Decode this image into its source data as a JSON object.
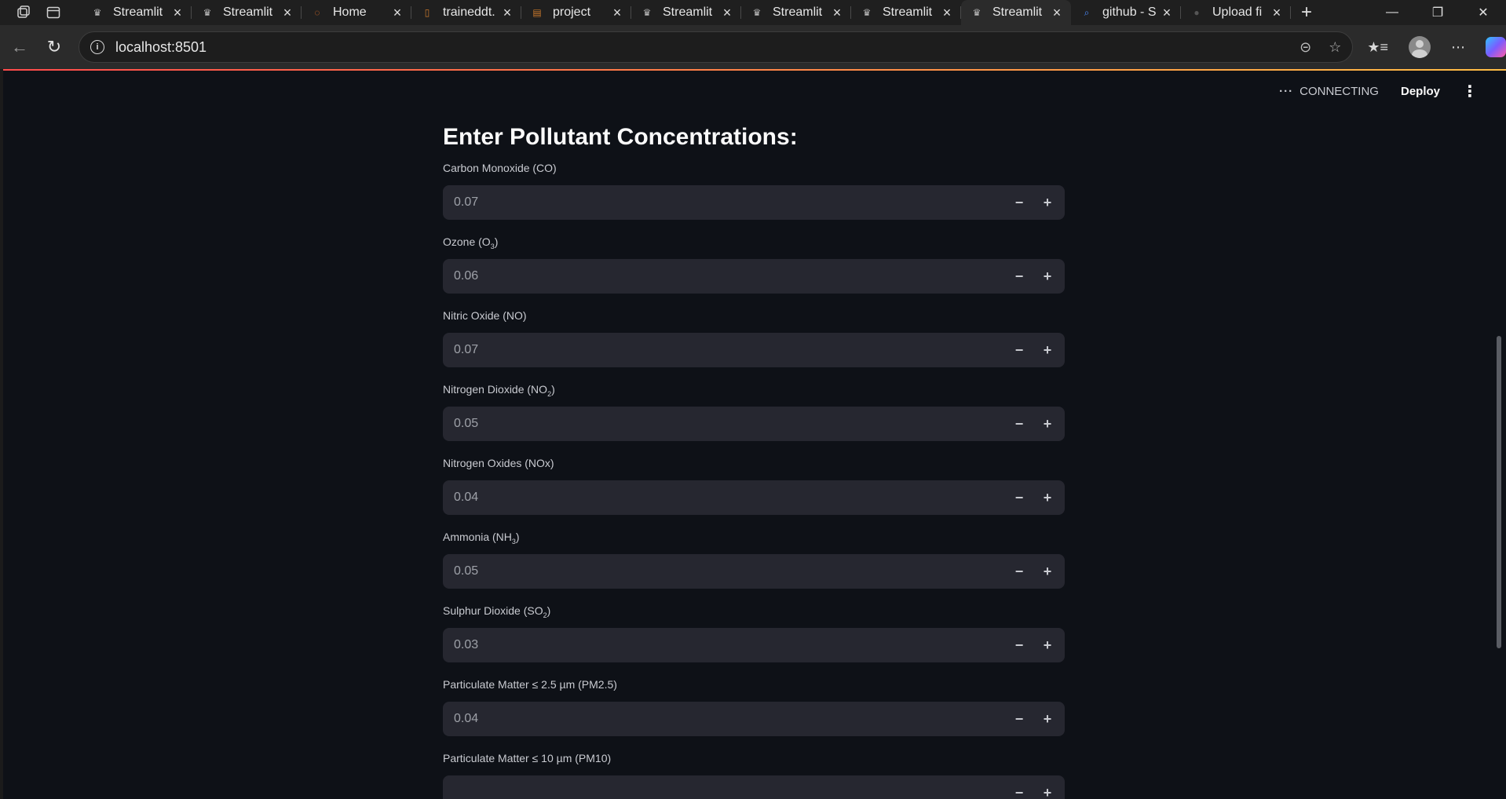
{
  "browser": {
    "tabs": [
      {
        "title": "Streamlit",
        "icon": "streamlit-crown-icon",
        "active": false
      },
      {
        "title": "Streamlit",
        "icon": "streamlit-crown-icon",
        "active": false
      },
      {
        "title": "Home",
        "icon": "jupyter-icon",
        "active": false
      },
      {
        "title": "traineddt.",
        "icon": "file-icon",
        "active": false
      },
      {
        "title": "project",
        "icon": "notebook-icon",
        "active": false
      },
      {
        "title": "Streamlit",
        "icon": "streamlit-crown-icon",
        "active": false
      },
      {
        "title": "Streamlit",
        "icon": "streamlit-crown-icon",
        "active": false
      },
      {
        "title": "Streamlit",
        "icon": "streamlit-crown-icon",
        "active": false
      },
      {
        "title": "Streamlit",
        "icon": "streamlit-crown-icon",
        "active": true
      },
      {
        "title": "github - S",
        "icon": "search-icon",
        "active": false
      },
      {
        "title": "Upload fi",
        "icon": "github-icon",
        "active": false
      }
    ],
    "url": "localhost:8501"
  },
  "app": {
    "status": {
      "connection": "CONNECTING",
      "deploy_label": "Deploy"
    },
    "heading": "Enter Pollutant Concentrations:",
    "fields": [
      {
        "label": "Carbon Monoxide (CO)",
        "sub": "",
        "suffix": "",
        "value": "0.07"
      },
      {
        "label": "Ozone (O",
        "sub": "3",
        "suffix": ")",
        "value": "0.06"
      },
      {
        "label": "Nitric Oxide (NO)",
        "sub": "",
        "suffix": "",
        "value": "0.07"
      },
      {
        "label": "Nitrogen Dioxide (NO",
        "sub": "2",
        "suffix": ")",
        "value": "0.05"
      },
      {
        "label": "Nitrogen Oxides (NOx)",
        "sub": "",
        "suffix": "",
        "value": "0.04"
      },
      {
        "label": "Ammonia (NH",
        "sub": "3",
        "suffix": ")",
        "value": "0.05"
      },
      {
        "label": "Sulphur Dioxide (SO",
        "sub": "2",
        "suffix": ")",
        "value": "0.03"
      },
      {
        "label": "Particulate Matter ≤ 2.5 µm (PM2.5)",
        "sub": "",
        "suffix": "",
        "value": "0.04"
      },
      {
        "label": "Particulate Matter ≤ 10 µm (PM10)",
        "sub": "",
        "suffix": "",
        "value": ""
      }
    ]
  }
}
